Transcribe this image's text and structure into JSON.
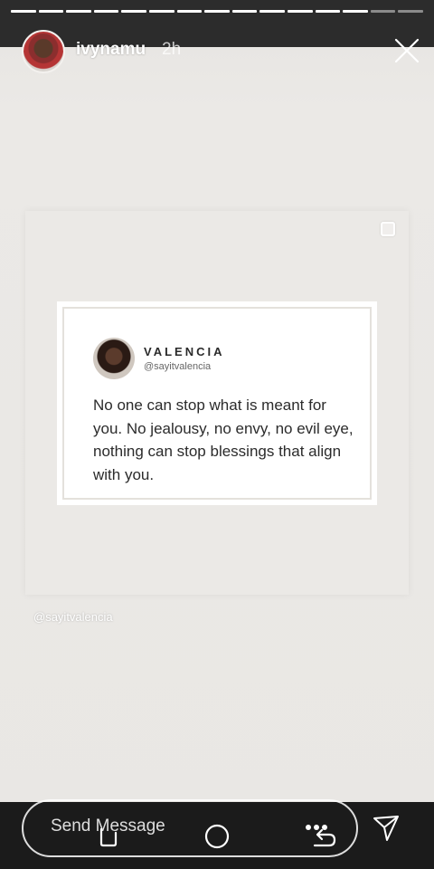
{
  "story": {
    "username": "ivynamu",
    "time": "2h",
    "progress_segments": 15,
    "progress_completed": 13
  },
  "post": {
    "author_name": "VALENCIA",
    "author_handle": "@sayitvalencia",
    "quote": "No one can stop what is meant for you. No jealousy, no envy, no evil eye, nothing can stop blessings that align with you.",
    "credit": "@sayitvalencia"
  },
  "bottom": {
    "send_placeholder": "Send Message"
  },
  "icons": {
    "close": "close-icon",
    "send": "paper-plane-icon",
    "nav_back": "back-icon",
    "nav_home": "home-icon",
    "nav_recent": "recent-apps-icon"
  },
  "colors": {
    "background": "#e9e7e4",
    "topbar": "#2c2c2c",
    "bottombar": "#1b1b1b",
    "text_dark": "#2b2b2b"
  }
}
